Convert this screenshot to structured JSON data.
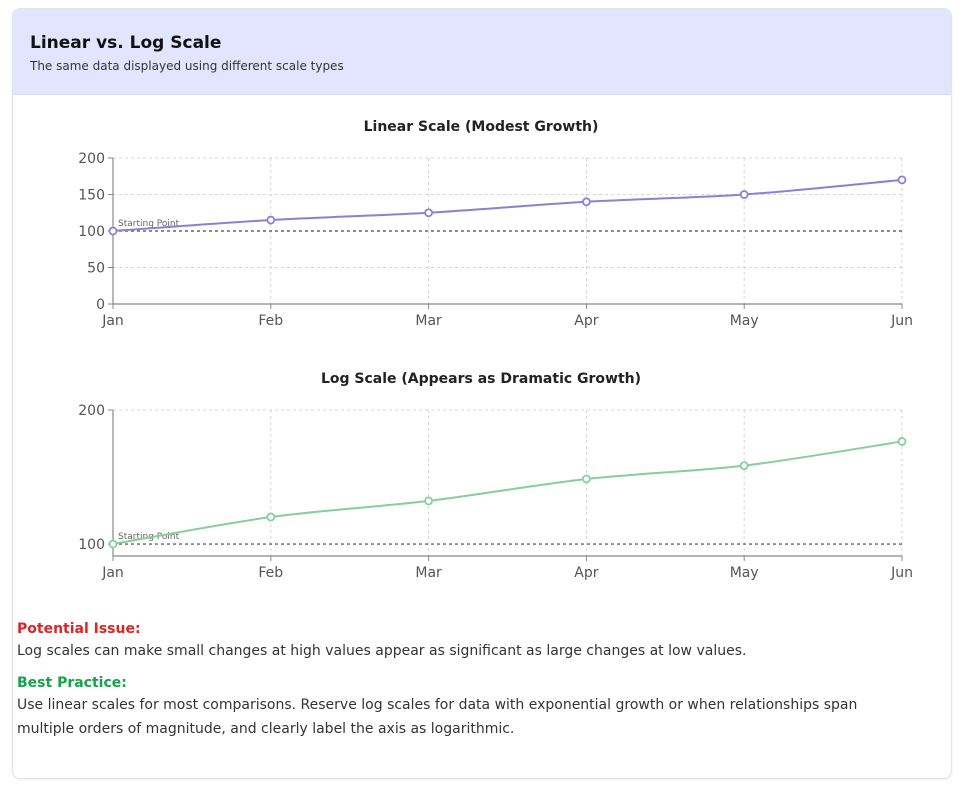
{
  "header": {
    "title": "Linear vs. Log Scale",
    "subtitle": "The same data displayed using different scale types"
  },
  "colors": {
    "header_bg": "#e1e6fe",
    "linear_series": "#8b80d6",
    "log_series": "#86cf9c",
    "issue": "#dc2626",
    "practice": "#16a34a"
  },
  "chart_data": [
    {
      "type": "line",
      "title": "Linear Scale (Modest Growth)",
      "scale": "linear",
      "categories": [
        "Jan",
        "Feb",
        "Mar",
        "Apr",
        "May",
        "Jun"
      ],
      "values": [
        100,
        115,
        125,
        140,
        150,
        170
      ],
      "ylim": [
        0,
        200
      ],
      "yticks": [
        0,
        50,
        100,
        150,
        200
      ],
      "grid": true,
      "reference_line": {
        "value": 100,
        "label": "Starting Point"
      }
    },
    {
      "type": "line",
      "title": "Log Scale (Appears as Dramatic Growth)",
      "scale": "log",
      "categories": [
        "Jan",
        "Feb",
        "Mar",
        "Apr",
        "May",
        "Jun"
      ],
      "values": [
        100,
        115,
        125,
        140,
        150,
        170
      ],
      "ylim": [
        94,
        200
      ],
      "yticks": [
        100,
        200
      ],
      "grid": true,
      "reference_line": {
        "value": 100,
        "label": "Starting Point"
      }
    }
  ],
  "notes": {
    "issue_heading": "Potential Issue:",
    "issue_text": "Log scales can make small changes at high values appear as significant as large changes at low values.",
    "practice_heading": "Best Practice:",
    "practice_text": "Use linear scales for most comparisons. Reserve log scales for data with exponential growth or when relationships span multiple orders of magnitude, and clearly label the axis as logarithmic."
  }
}
